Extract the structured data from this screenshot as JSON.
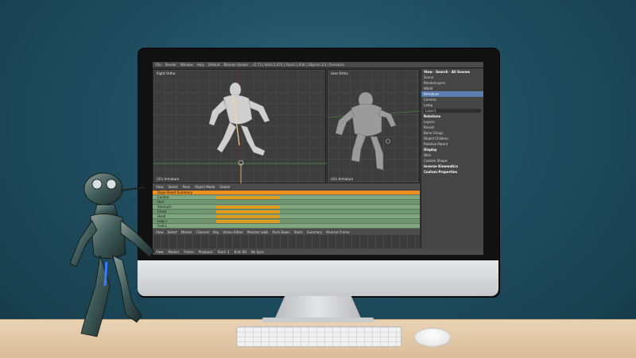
{
  "screen": {
    "topbar_items": [
      "File",
      "Render",
      "Window",
      "Help",
      "Default",
      "Blender Render",
      "v2.73 | Verts:1,974 | Faces:1,934 | Objects:1/3 | Armature"
    ],
    "viewport_left": {
      "label": "Right Ortho",
      "footer": "(41) Armature"
    },
    "viewport_right": {
      "label": "User Ortho",
      "footer": "(41) Armature"
    },
    "viewport_header_items": [
      "View",
      "Select",
      "Pose",
      "Object Mode",
      "Global"
    ],
    "properties_panel": {
      "tabs": [
        "View",
        "Search",
        "All Scenes"
      ],
      "outliner": [
        "Scene",
        "RenderLayers",
        "World",
        "Armature",
        "Camera",
        "Lamp"
      ],
      "bone_name": "Layer1",
      "sections": [
        "Relations",
        "Display",
        "Inverse Kinematics",
        "Custom Properties"
      ],
      "fields": [
        "Layers:",
        "Parent:",
        "Bone Group:",
        "Object Children",
        "Relative Parent",
        "Wire",
        "Custom Shape:"
      ]
    },
    "dopesheet_rows": [
      "Dope Sheet Summary",
      "Control",
      "Hull",
      "Stomach",
      "Chest",
      "Head",
      "Legs.L",
      "Foot.L"
    ],
    "dopesheet_header_items": [
      "View",
      "Select",
      "Marker",
      "Channel",
      "Key",
      "Action Editor",
      "Monster walk",
      "Push Down",
      "Stash",
      "Summary",
      "Nearest Frame"
    ],
    "timeline_footer_items": [
      "View",
      "Marker",
      "Frame",
      "Playback",
      "Start: 1",
      "End: 60",
      "No Sync"
    ]
  },
  "colors": {
    "wall": "#1f4e60",
    "desk": "#e2c8a6",
    "dopesheet_bg": "#5e7360",
    "keyframe": "#e09a1c",
    "summary": "#f09020"
  }
}
